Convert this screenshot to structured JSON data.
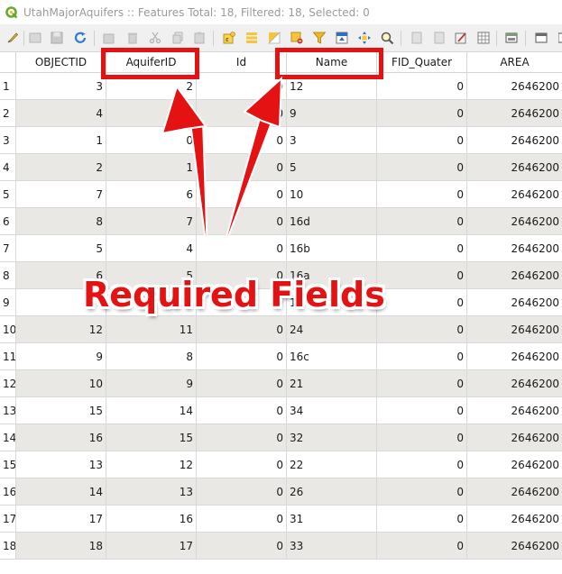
{
  "window": {
    "title": "UtahMajorAquifers :: Features Total: 18, Filtered: 18, Selected: 0"
  },
  "toolbar": {
    "icons": [
      "pencil-icon",
      "multi-edit-icon",
      "save-icon",
      "reload-icon",
      "add-feature-icon",
      "delete-icon",
      "cut-icon",
      "copy-icon",
      "paste-icon",
      "select-by-expression-icon",
      "select-all-icon",
      "invert-selection-icon",
      "deselect-icon",
      "filter-icon",
      "move-selection-to-top-icon",
      "pan-to-selection-icon",
      "zoom-to-selection-icon",
      "new-field-icon",
      "delete-field-icon",
      "field-calculator-icon",
      "conditional-formatting-icon",
      "dock-icon",
      "actions-icon"
    ]
  },
  "table": {
    "columns": [
      "OBJECTID",
      "AquiferID",
      "Id",
      "Name",
      "FID_Quater",
      "AREA"
    ],
    "rows": [
      [
        "1",
        "3",
        "2",
        "0",
        "12",
        "0",
        "2646200"
      ],
      [
        "2",
        "4",
        "3",
        "0",
        "9",
        "0",
        "2646200"
      ],
      [
        "3",
        "1",
        "0",
        "0",
        "3",
        "0",
        "2646200"
      ],
      [
        "4",
        "2",
        "1",
        "0",
        "5",
        "0",
        "2646200"
      ],
      [
        "5",
        "7",
        "6",
        "0",
        "10",
        "0",
        "2646200"
      ],
      [
        "6",
        "8",
        "7",
        "0",
        "16d",
        "0",
        "2646200"
      ],
      [
        "7",
        "5",
        "4",
        "0",
        "16b",
        "0",
        "2646200"
      ],
      [
        "8",
        "6",
        "5",
        "0",
        "16a",
        "0",
        "2646200"
      ],
      [
        "9",
        "11",
        "10",
        "0",
        "18",
        "0",
        "2646200"
      ],
      [
        "10",
        "12",
        "11",
        "0",
        "24",
        "0",
        "2646200"
      ],
      [
        "11",
        "9",
        "8",
        "0",
        "16c",
        "0",
        "2646200"
      ],
      [
        "12",
        "10",
        "9",
        "0",
        "21",
        "0",
        "2646200"
      ],
      [
        "13",
        "15",
        "14",
        "0",
        "34",
        "0",
        "2646200"
      ],
      [
        "14",
        "16",
        "15",
        "0",
        "32",
        "0",
        "2646200"
      ],
      [
        "15",
        "13",
        "12",
        "0",
        "22",
        "0",
        "2646200"
      ],
      [
        "16",
        "14",
        "13",
        "0",
        "26",
        "0",
        "2646200"
      ],
      [
        "17",
        "17",
        "16",
        "0",
        "31",
        "0",
        "2646200"
      ],
      [
        "18",
        "18",
        "17",
        "0",
        "33",
        "0",
        "2646200"
      ]
    ]
  },
  "annotation": {
    "label": "Required Fields",
    "color": "#e41212"
  }
}
